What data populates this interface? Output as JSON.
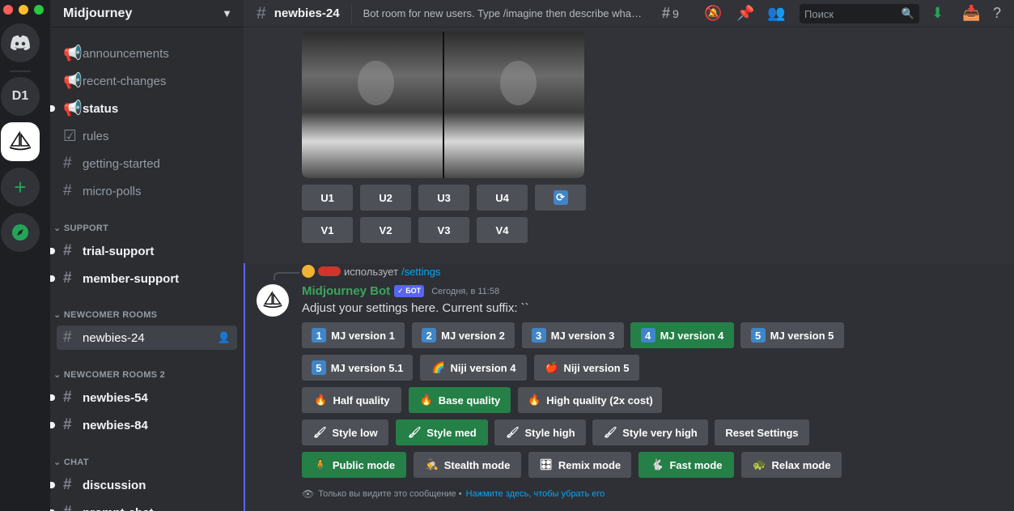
{
  "server": {
    "name": "Midjourney"
  },
  "rail": {
    "d1_label": "D1"
  },
  "channels": [
    {
      "name": "announcements",
      "type": "announce",
      "bold": false
    },
    {
      "name": "recent-changes",
      "type": "announce",
      "bold": false
    },
    {
      "name": "status",
      "type": "announce",
      "bold": true
    },
    {
      "name": "rules",
      "type": "rules",
      "bold": false
    },
    {
      "name": "getting-started",
      "type": "text",
      "bold": false
    },
    {
      "name": "micro-polls",
      "type": "text",
      "bold": false
    }
  ],
  "categories": {
    "support": "SUPPORT",
    "newcomer": "NEWCOMER ROOMS",
    "newcomer2": "NEWCOMER ROOMS 2",
    "chat": "CHAT"
  },
  "support_channels": [
    "trial-support",
    "member-support"
  ],
  "newcomer_channels": [
    "newbies-24"
  ],
  "newcomer2_channels": [
    "newbies-54",
    "newbies-84"
  ],
  "chat_channels": [
    "discussion",
    "prompt-chat"
  ],
  "topbar": {
    "channel": "newbies-24",
    "topic": "Bot room for new users. Type /imagine then describe what you want to draw.",
    "members_count": "9",
    "search_placeholder": "Поиск"
  },
  "upscale_buttons": [
    "U1",
    "U2",
    "U3",
    "U4"
  ],
  "variation_buttons": [
    "V1",
    "V2",
    "V3",
    "V4"
  ],
  "message": {
    "reply_text": "использует",
    "reply_cmd": "/settings",
    "author": "Midjourney Bot",
    "badge": "✓ БОТ",
    "time": "Сегодня, в 11:58",
    "content": "Adjust your settings here. Current suffix: ``",
    "ephemeral_text": "Только вы видите это сообщение •",
    "ephemeral_link": "Нажмите здесь, чтобы убрать его"
  },
  "settings_buttons": {
    "v1": {
      "icon": "1",
      "label": "MJ version 1"
    },
    "v2": {
      "icon": "2",
      "label": "MJ version 2"
    },
    "v3": {
      "icon": "3",
      "label": "MJ version 3"
    },
    "v4": {
      "icon": "4",
      "label": "MJ version 4"
    },
    "v5": {
      "icon": "5",
      "label": "MJ version 5"
    },
    "v51": {
      "icon": "5",
      "label": "MJ version 5.1"
    },
    "niji4": {
      "icon": "🌈",
      "label": "Niji version 4"
    },
    "niji5": {
      "icon": "🍎",
      "label": "Niji version 5"
    },
    "half": {
      "icon": "🔥",
      "label": "Half quality"
    },
    "base": {
      "icon": "🔥",
      "label": "Base quality"
    },
    "high": {
      "icon": "🔥",
      "label": "High quality (2x cost)"
    },
    "style_low": {
      "icon": "🖌",
      "label": "Style low"
    },
    "style_med": {
      "icon": "🖌",
      "label": "Style med"
    },
    "style_high": {
      "icon": "🖌",
      "label": "Style high"
    },
    "style_vhigh": {
      "icon": "🖌",
      "label": "Style very high"
    },
    "reset": {
      "label": "Reset Settings"
    },
    "public": {
      "icon": "🧍",
      "label": "Public mode"
    },
    "stealth": {
      "icon": "🕵",
      "label": "Stealth mode"
    },
    "remix": {
      "icon": "🎛",
      "label": "Remix mode"
    },
    "fast": {
      "icon": "🐇",
      "label": "Fast mode"
    },
    "relax": {
      "icon": "🐢",
      "label": "Relax mode"
    }
  },
  "colors": {
    "accent": "#5865f2",
    "selected_button": "#248046",
    "bot_name": "#3ba55d",
    "link": "#00a8fc"
  }
}
